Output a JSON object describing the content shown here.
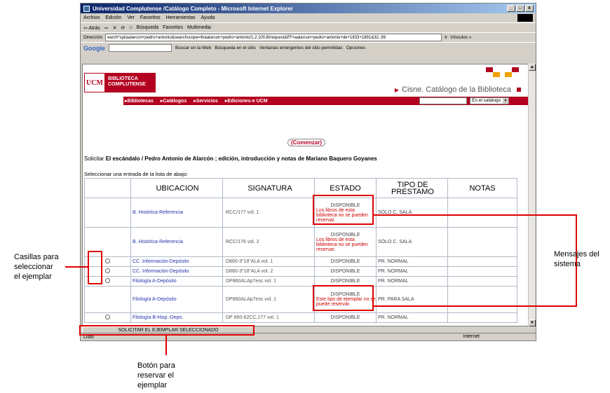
{
  "window": {
    "title": "Universidad Complutense /Catálogo Completo - Microsoft Internet Explorer",
    "min": "_",
    "max": "□",
    "close": "x"
  },
  "menu": [
    "Archivo",
    "Edición",
    "Ver",
    "Favoritos",
    "Herramientas",
    "Ayuda"
  ],
  "toolbar": [
    "⇦ Atrás",
    "⇨",
    "✕",
    "⟳",
    "⌂",
    "Búsqueda",
    "Favoritos",
    "Multimedia"
  ],
  "address": {
    "label": "Dirección",
    "value": "earch*spi/aalarcon+pedro+antonio&searchscope=6/aalarcon+pedro+antonio/1,2,100,B/request&FF=aalarcon+pedro+antonio+de+1833+1891&32,,99",
    "go": "Ir",
    "links": "Vínculos »"
  },
  "google": {
    "logo": "Google",
    "web": "Buscar en la Web",
    "site": "Búsqueda en el sitio",
    "popups": "Ventanas emergentes del sitio permitidas",
    "options": "Opciones"
  },
  "logo": {
    "ucm": "UCM",
    "line1": "BIBLIOTECA",
    "line2": "COMPLUTENSE"
  },
  "cisne": "Cisne. Catálogo de la Biblioteca",
  "nav": [
    "▸Bibliotecas",
    "▸Catálogos",
    "▸Servicios",
    "▸Ediciones-e UCM"
  ],
  "nav_select": "En el catálogo",
  "comenzar": "(Comenzar)",
  "solicitar_prefix": "Solicitar",
  "solicitar_title": "El escándalo / Pedro Antonio de Alarcón ; edición, introducción y notas de Mariano Baquero Goyanes",
  "seleccionar": "Seleccionar una entrada de la lista de abajo:",
  "table": {
    "headers": [
      "UBICACION",
      "SIGNATURA",
      "ESTADO",
      "TIPO DE PRESTAMO",
      "NOTAS"
    ],
    "rows": [
      {
        "ubicacion": "B. Histórica-Referencia",
        "signatura": "RCC/177  vol. 1",
        "estado": "DISPONIBLE",
        "mensaje": "Los libros de esta biblioteca no se pueden reservar.",
        "tipo": "SÓLO C. SALA"
      },
      {
        "ubicacion": "B. Histórica-Referencia",
        "signatura": "RCC/178  vol. 2",
        "estado": "DISPONIBLE",
        "mensaje": "Los libros de esta biblioteca no se pueden reservar.",
        "tipo": "SÓLO C. SALA"
      },
      {
        "ubicacion": "CC. Información-Depósito",
        "signatura": "D860-3\"18\"ALA  vol. 1",
        "estado": "DISPONIBLE",
        "mensaje": "",
        "tipo": "PR. NORMAL"
      },
      {
        "ubicacion": "CC. Información-Depósito",
        "signatura": "D860-3\"18\"ALA  vol. 2",
        "estado": "DISPONIBLE",
        "mensaje": "",
        "tipo": "PR. NORMAL"
      },
      {
        "ubicacion": "Filología A-Depósito",
        "signatura": "DP860ALAp7esc  vol. 1",
        "estado": "DISPONIBLE",
        "mensaje": "",
        "tipo": "PR. NORMAL"
      },
      {
        "ubicacion": "Filología A-Depósito",
        "signatura": "DP860ALAp7esc  vol. 1",
        "estado": "DISPONIBLE",
        "mensaje": "Este tipo de ejemplar no se puede reservar.",
        "tipo": "PR. PARA SALA"
      },
      {
        "ubicacion": "Filología B-Hisp.-Depo.",
        "signatura": "DP 860-82CC,177  vol. 1",
        "estado": "DISPONIBLE",
        "mensaje": "",
        "tipo": "PR. NORMAL"
      }
    ]
  },
  "submit": "SOLICITAR EL EJEMPLAR SELECCIONADO",
  "status": {
    "left": "Listo",
    "zone": "Internet"
  },
  "annotations": {
    "casillas": [
      "Casillas para",
      "seleccionar",
      "el ejemplar"
    ],
    "mensajes": [
      "Mensajes del",
      "sistema"
    ],
    "boton": [
      "Botón para",
      "reservar el",
      "ejemplar"
    ]
  },
  "colors": {
    "brand": "#b40020",
    "highlight": "#e00000",
    "link": "#2233aa"
  }
}
